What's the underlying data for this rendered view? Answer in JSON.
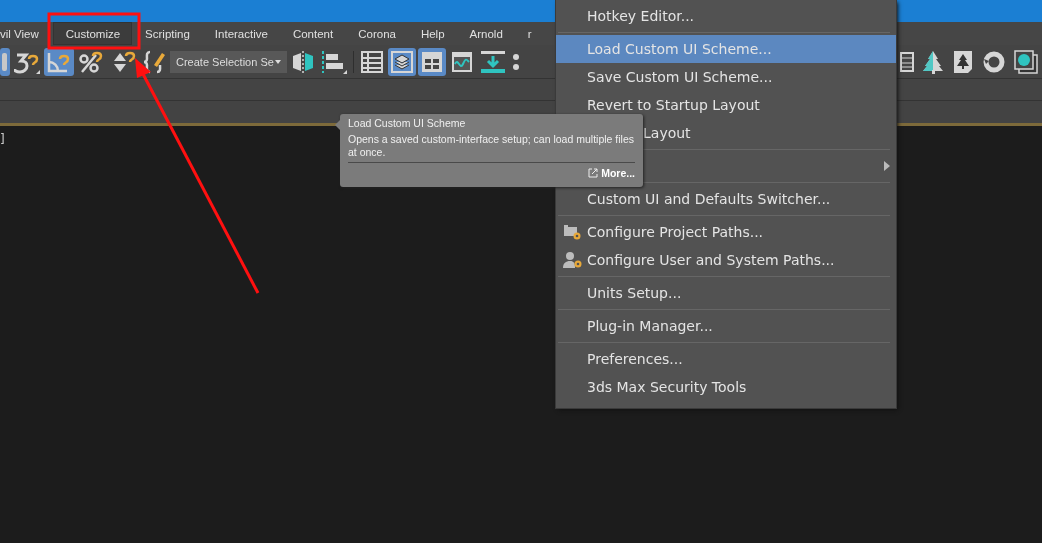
{
  "menu_bar": [
    {
      "label": "vil View",
      "selected": false
    },
    {
      "label": "Customize",
      "selected": true
    },
    {
      "label": "Scripting",
      "selected": false
    },
    {
      "label": "Interactive",
      "selected": false
    },
    {
      "label": "Content",
      "selected": false
    },
    {
      "label": "Corona",
      "selected": false
    },
    {
      "label": "Help",
      "selected": false
    },
    {
      "label": "Arnold",
      "selected": false
    },
    {
      "label": "r",
      "selected": false
    }
  ],
  "toolbar": {
    "left": [
      {
        "kind": "edge",
        "selected": true
      },
      {
        "kind": "snap3",
        "selected": false
      },
      {
        "kind": "angle",
        "selected": true
      },
      {
        "kind": "percent",
        "selected": false
      },
      {
        "kind": "spinner",
        "selected": false
      },
      {
        "kind": "braces",
        "selected": false
      }
    ],
    "selection_set": {
      "value": "Create Selection Se"
    },
    "right": [
      {
        "kind": "mirror",
        "selected": false
      },
      {
        "kind": "align",
        "selected": false
      },
      {
        "kind": "list",
        "selected": false
      },
      {
        "kind": "layers",
        "selected": true
      },
      {
        "kind": "panels",
        "selected": true
      },
      {
        "kind": "curve",
        "selected": false
      },
      {
        "kind": "download",
        "selected": false
      },
      {
        "kind": "dots",
        "selected": false
      }
    ],
    "far_right": [
      {
        "kind": "grid",
        "selected": false
      },
      {
        "kind": "tree",
        "selected": false
      },
      {
        "kind": "treedoc",
        "selected": false
      },
      {
        "kind": "ring",
        "selected": false
      },
      {
        "kind": "frame",
        "selected": false
      }
    ]
  },
  "viewport": {
    "text": "]"
  },
  "dropdown_menu": [
    {
      "kind": "item",
      "label": "Hotkey Editor...",
      "selected": false
    },
    {
      "kind": "separator"
    },
    {
      "kind": "item",
      "label": "Load Custom UI Scheme...",
      "selected": true
    },
    {
      "kind": "item",
      "label": "Save Custom UI Scheme...",
      "selected": false
    },
    {
      "kind": "item",
      "label": "Revert to Startup Layout",
      "selected": false
    },
    {
      "kind": "partial",
      "label": "Layout",
      "selected": false
    },
    {
      "kind": "separator"
    },
    {
      "kind": "submenu",
      "selected": false
    },
    {
      "kind": "separator"
    },
    {
      "kind": "item",
      "label": "Custom UI and Defaults Switcher...",
      "selected": false
    },
    {
      "kind": "separator"
    },
    {
      "kind": "iconitem",
      "label": "Configure Project Paths...",
      "selected": false
    },
    {
      "kind": "iconitem",
      "label": "Configure User and System Paths...",
      "selected": false
    },
    {
      "kind": "separator"
    },
    {
      "kind": "item",
      "label": "Units Setup...",
      "selected": false
    },
    {
      "kind": "separator"
    },
    {
      "kind": "item",
      "label": "Plug-in Manager...",
      "selected": false
    },
    {
      "kind": "separator"
    },
    {
      "kind": "item",
      "label": "Preferences...",
      "selected": false
    },
    {
      "kind": "item",
      "label": "3ds Max Security Tools",
      "selected": false
    }
  ],
  "tooltip": {
    "title": "Load Custom UI Scheme",
    "body": "Opens a saved custom-interface setup; can load multiple files at once.",
    "link": "More..."
  }
}
